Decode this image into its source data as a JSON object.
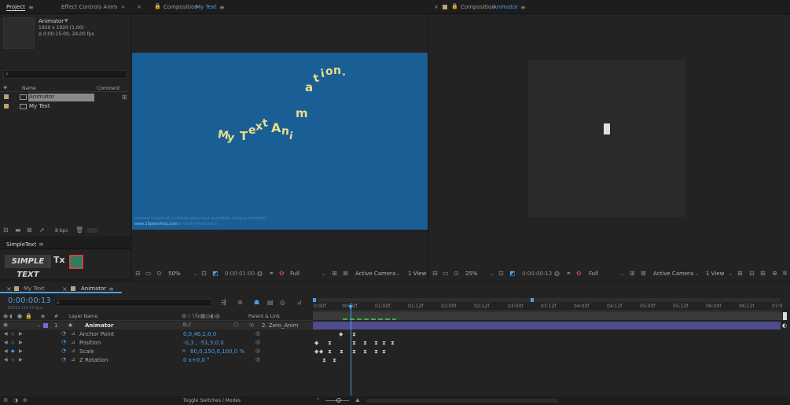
{
  "project": {
    "tab_project": "Project",
    "tab_effect_controls": "Effect Controls Anim",
    "selected_name": "Animator",
    "selected_dims": "1920 x 1920 (1,00)",
    "selected_duration": "Δ 0:00:15:00, 24,00 fps",
    "search_placeholder": "",
    "col_name": "Name",
    "col_comment": "Comment",
    "items": [
      {
        "name": "Animator"
      },
      {
        "name": "My Text"
      }
    ],
    "bpc": "8 bpc"
  },
  "simpletext": {
    "title": "SimpleText",
    "logo": "SIMPLE TEXT",
    "tx": "Tx"
  },
  "viewer1": {
    "close": "×",
    "label": "Composition",
    "comp": "My Text",
    "caption1": "preview in part of a tutorial about text animation using a controller",
    "caption2": "www.10pointfrog.com",
    "caption3": "for more information",
    "zoom": "50%",
    "time": "0:00:01:00",
    "res": "Full",
    "camera": "Active Camera",
    "views": "1 View",
    "letters": [
      "M",
      "y",
      "T",
      "e",
      "x",
      "t",
      "A",
      "n",
      "i",
      "m",
      "a",
      "t",
      "i",
      "o",
      "n",
      "."
    ]
  },
  "viewer2": {
    "close": "×",
    "label": "Composition",
    "comp": "Animator",
    "zoom": "25%",
    "time": "0:00:00:13",
    "res": "Full",
    "camera": "Active Camera",
    "views": "1 View"
  },
  "timeline": {
    "tab_mytext": "My Text",
    "tab_animator": "Animator",
    "timecode": "0:00:00:13",
    "frames": "00013 (24.00 fps)",
    "col_num": "#",
    "col_layer": "Layer Name",
    "col_parent": "Parent & Link",
    "layer": {
      "num": "1",
      "name": "Animator",
      "parent": "2. Zero_Anim"
    },
    "props": [
      {
        "name": "Anchor Point",
        "value": "0,0,46,1,0,0"
      },
      {
        "name": "Position",
        "value": "-0,3 , -51,5,0,0"
      },
      {
        "name": "Scale",
        "value": "80,0,150,0,100,0 %"
      },
      {
        "name": "Z Rotation",
        "value": "0 x+0,0 °"
      }
    ],
    "ruler": [
      "0:00f",
      "00:12f",
      "01:00f",
      "01:12f",
      "02:00f",
      "02:12f",
      "03:00f",
      "03:12f",
      "04:00f",
      "04:12f",
      "05:00f",
      "05:12f",
      "06:00f",
      "06:12f",
      "07:0"
    ],
    "toggle": "Toggle Switches / Modes"
  },
  "colors": {
    "accent": "#4a9fe8",
    "comp_bg": "#1a5e96",
    "text_yellow": "#e9df86",
    "layer_bar": "#4f4d8e"
  }
}
